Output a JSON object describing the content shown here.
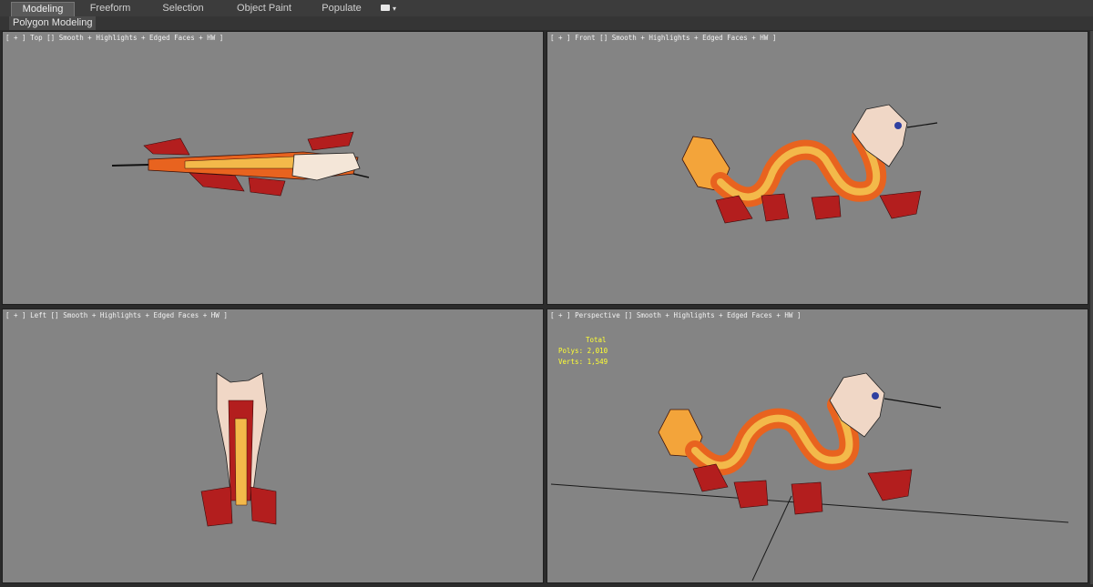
{
  "ribbon": {
    "tabs": [
      {
        "label": "Modeling",
        "active": true
      },
      {
        "label": "Freeform",
        "active": false
      },
      {
        "label": "Selection",
        "active": false
      },
      {
        "label": "Object Paint",
        "active": false
      },
      {
        "label": "Populate",
        "active": false
      }
    ],
    "options_icon": "ribbon-options-icon",
    "sub_label": "Polygon Modeling"
  },
  "viewports": {
    "top": {
      "label": "[ + ] Top [] Smooth + Highlights + Edged Faces + HW ]"
    },
    "front": {
      "label": "[ + ] Front [] Smooth + Highlights + Edged Faces + HW ]"
    },
    "left": {
      "label": "[ + ] Left [] Smooth + Highlights + Edged Faces + HW ]"
    },
    "perspective": {
      "label": "[ + ] Perspective [] Smooth + Highlights + Edged Faces + HW ]",
      "stats_total": "Total",
      "stats_polys": "Polys: 2,010",
      "stats_verts": "Verts: 1,549"
    }
  },
  "colors": {
    "viewport_bg": "#848484",
    "body_orange": "#e8631f",
    "belly_yellow": "#f3b94a",
    "claw_red": "#b31e1e",
    "stats_yellow": "#ffff33"
  }
}
